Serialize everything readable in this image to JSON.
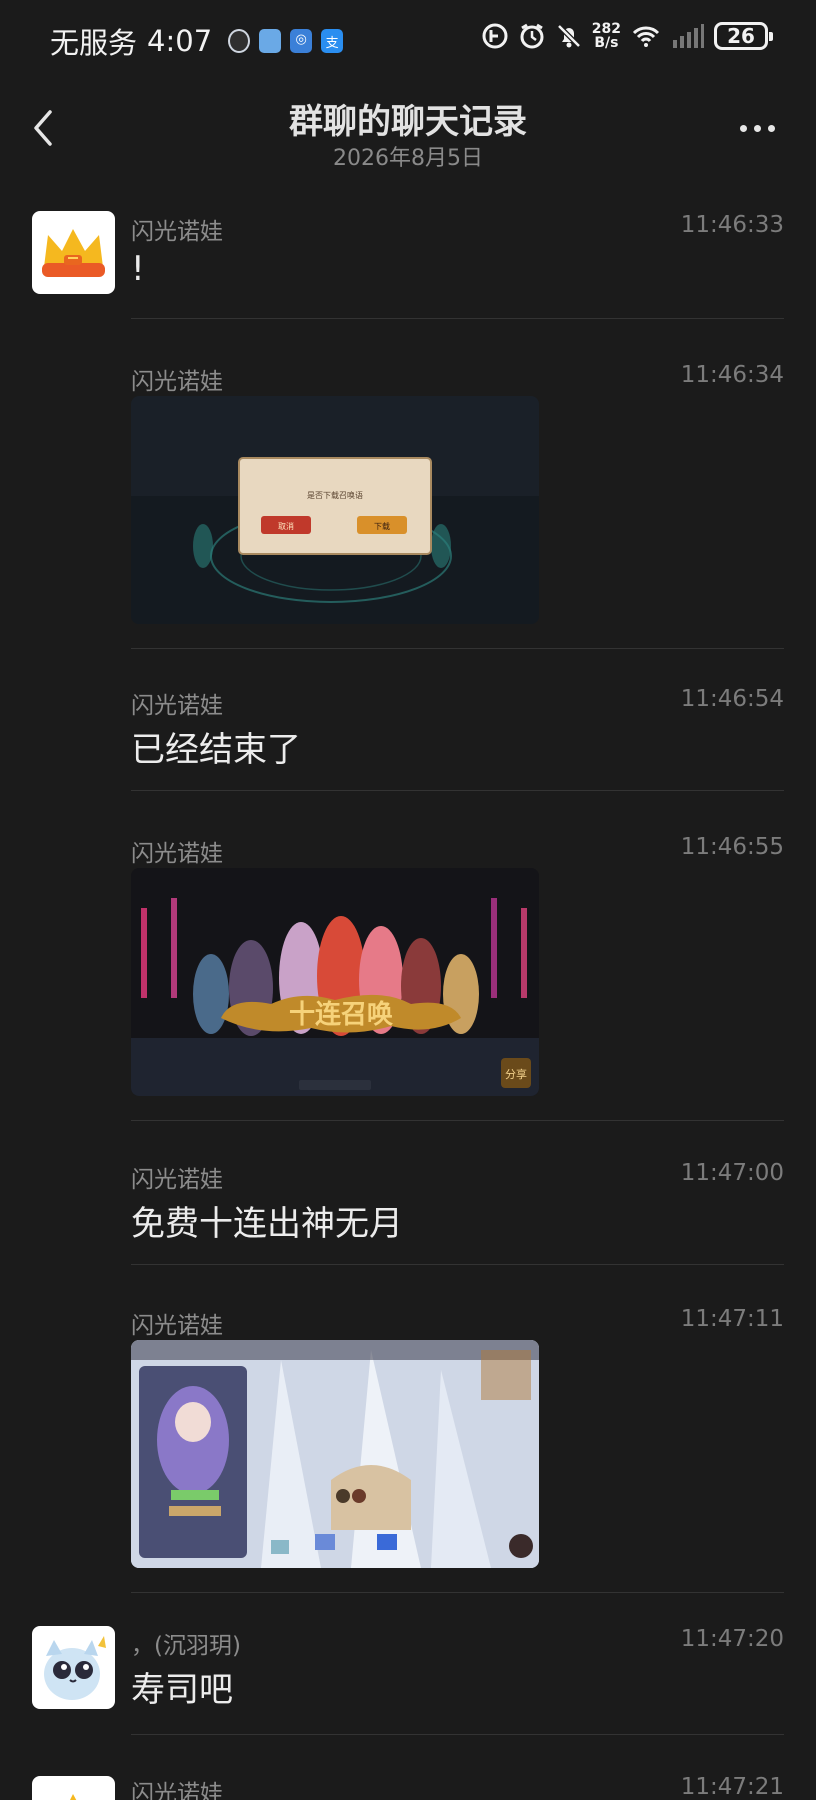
{
  "status_bar": {
    "carrier": "无服务",
    "time": "4:07",
    "net_speed_value": "282",
    "net_speed_unit": "B/s",
    "battery": "26",
    "apps": [
      "qq-icon",
      "calendar-icon",
      "security-icon",
      "alipay-icon"
    ],
    "indicators": [
      "hd-icon",
      "alarm-icon",
      "mute-icon",
      "wifi-icon",
      "signal-icon"
    ]
  },
  "header": {
    "title": "群聊的聊天记录",
    "subtitle": "2026年8月5日"
  },
  "messages": [
    {
      "sender": "闪光诺娃",
      "time": "11:46:33",
      "type": "text",
      "text": "!",
      "avatar": "crown-avatar"
    },
    {
      "sender": "闪光诺娃",
      "time": "11:46:34",
      "type": "image",
      "image_text": [
        "是否下载召唤语",
        "取消",
        "下载"
      ]
    },
    {
      "sender": "闪光诺娃",
      "time": "11:46:54",
      "type": "text",
      "text": "已经结束了"
    },
    {
      "sender": "闪光诺娃",
      "time": "11:46:55",
      "type": "image",
      "image_text": [
        "十连召唤",
        "分享"
      ]
    },
    {
      "sender": "闪光诺娃",
      "time": "11:47:00",
      "type": "text",
      "text": "免费十连出神无月"
    },
    {
      "sender": "闪光诺娃",
      "time": "11:47:11",
      "type": "image",
      "image_text": []
    },
    {
      "sender": "，(沉羽玥)",
      "time": "11:47:20",
      "type": "text",
      "text": "寿司吧",
      "avatar": "cartoon-cat-avatar"
    },
    {
      "sender": "闪光诺娃",
      "time": "11:47:21",
      "type": "text",
      "text": "",
      "avatar": "crown-avatar"
    }
  ],
  "colors": {
    "background": "#1b1b1b",
    "text_primary": "#ececec",
    "text_secondary": "#8c8c8c",
    "divider": "#333333"
  }
}
